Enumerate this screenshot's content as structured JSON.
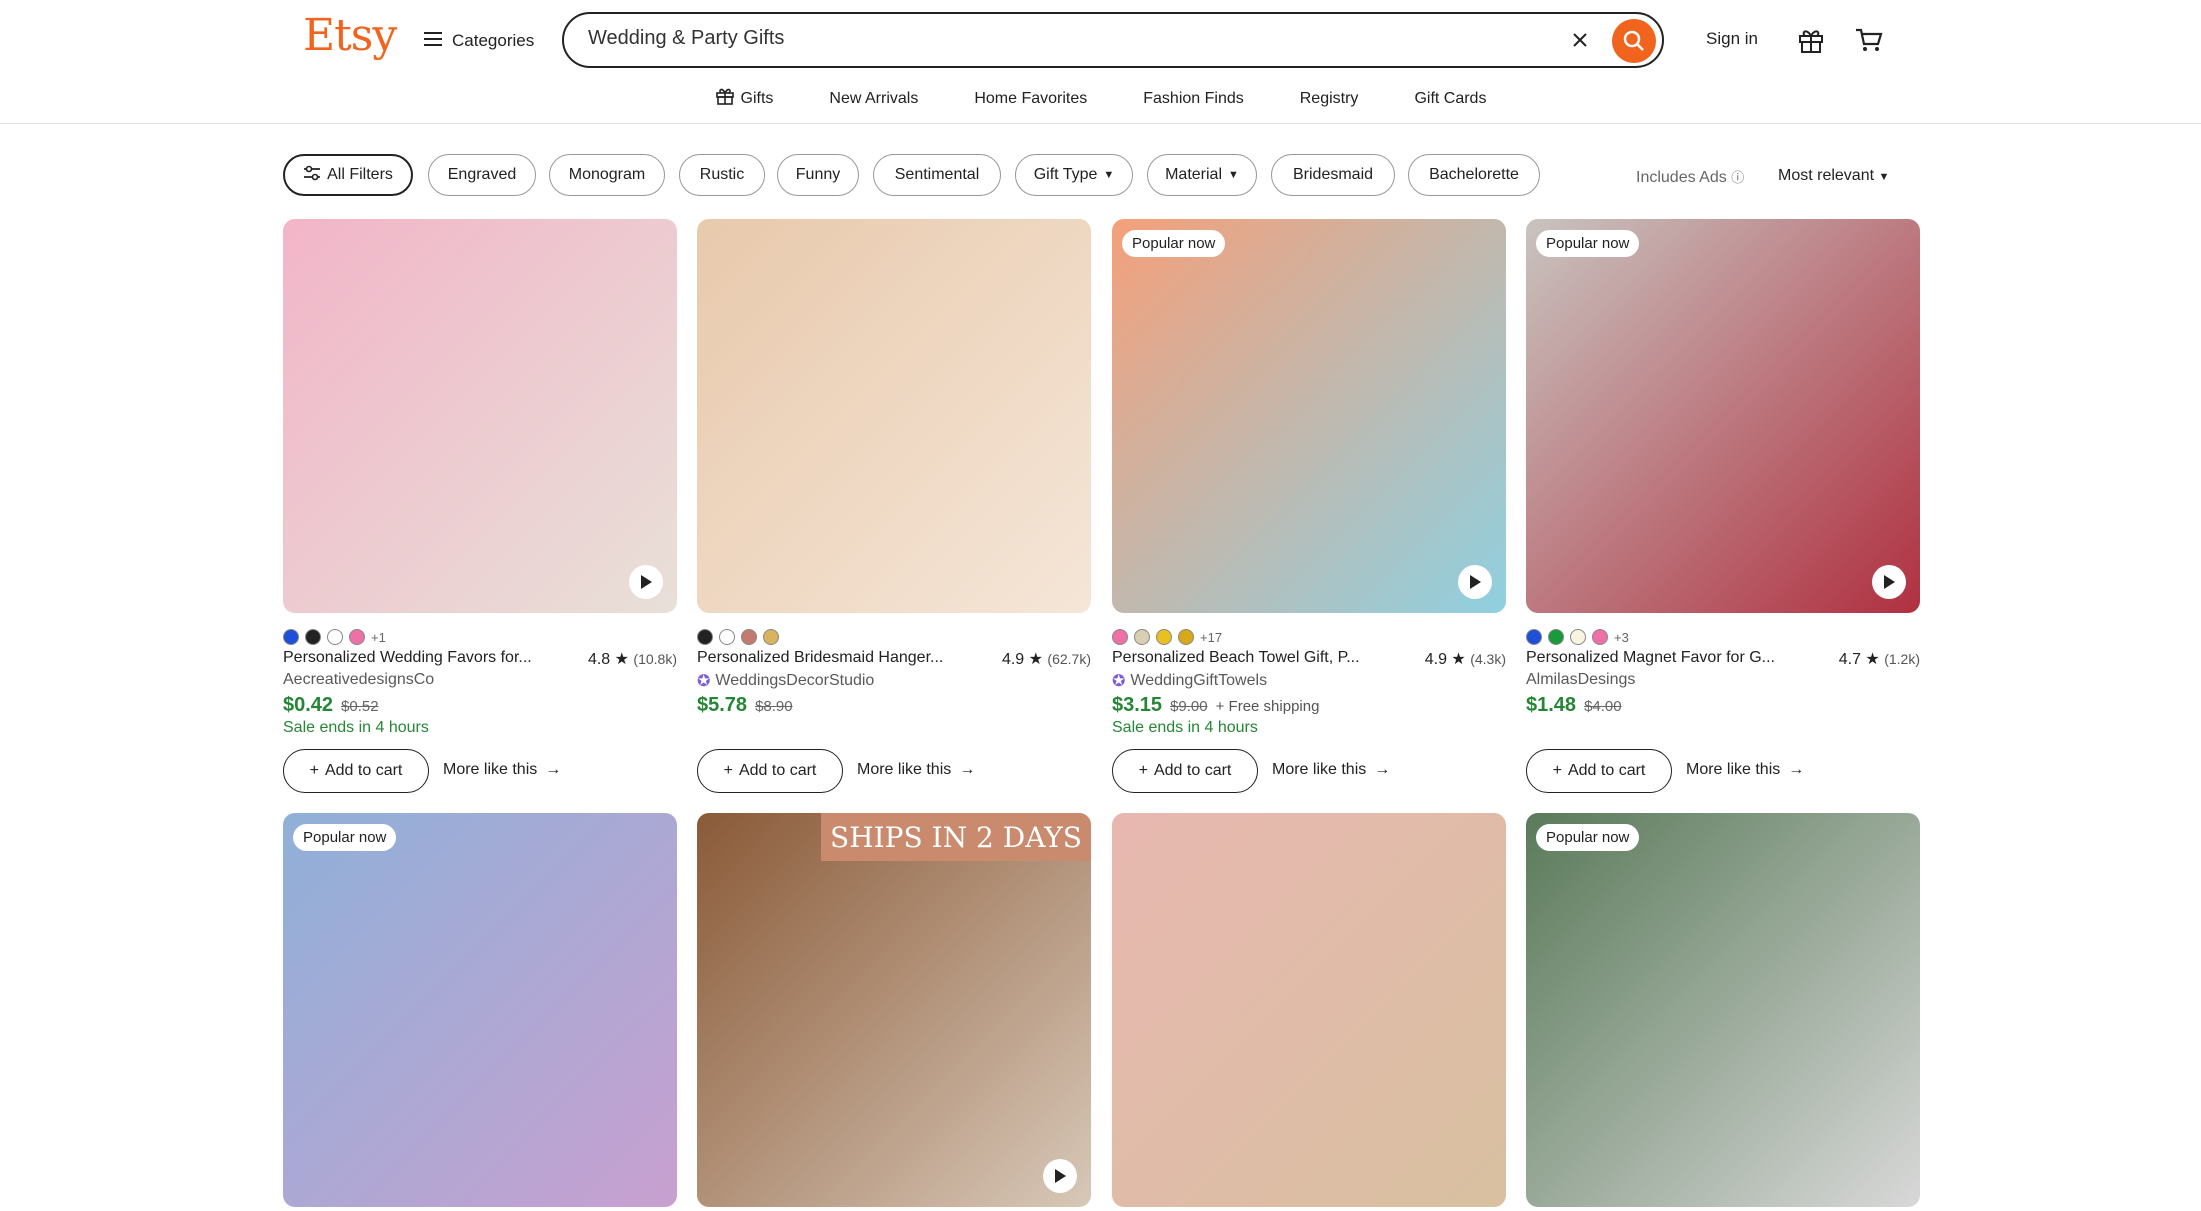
{
  "header": {
    "logo": "Etsy",
    "categories_label": "Categories",
    "search_value": "Wedding & Party Gifts",
    "signin": "Sign in",
    "nav": [
      "Gifts",
      "New Arrivals",
      "Home Favorites",
      "Fashion Finds",
      "Registry",
      "Gift Cards"
    ]
  },
  "filters": {
    "all": "All Filters",
    "chips": [
      "Engraved",
      "Monogram",
      "Rustic",
      "Funny",
      "Sentimental",
      "Gift Type",
      "Material",
      "Bridesmaid",
      "Bachelorette"
    ],
    "ads": "Includes Ads",
    "sort": "Most relevant"
  },
  "common": {
    "add_to_cart": "Add to cart",
    "more_like": "More like this"
  },
  "products": [
    {
      "title": "Personalized Wedding Favors for...",
      "rating": "4.8",
      "count": "(10.8k)",
      "shop": "AecreativedesignsCo",
      "star_seller": false,
      "price": "$0.42",
      "orig": "$0.52",
      "shipping": "",
      "sale": "Sale ends in 4 hours",
      "badge": "",
      "swatches": [
        "#1e4fd8",
        "#222222",
        "#ffffff",
        "#ef6fa7"
      ],
      "more_swatches": "+1",
      "video": true,
      "colors": [
        "#f2b5c8",
        "#e8e0d8"
      ]
    },
    {
      "title": "Personalized Bridesmaid Hanger...",
      "rating": "4.9",
      "count": "(62.7k)",
      "shop": "WeddingsDecorStudio",
      "star_seller": true,
      "price": "$5.78",
      "orig": "$8.90",
      "shipping": "",
      "sale": "",
      "badge": "",
      "swatches": [
        "#222222",
        "#ffffff",
        "#c27b6e",
        "#d8b460"
      ],
      "more_swatches": "",
      "video": false,
      "colors": [
        "#e8c9ac",
        "#f5e6d8"
      ]
    },
    {
      "title": "Personalized Beach Towel Gift, P...",
      "rating": "4.9",
      "count": "(4.3k)",
      "shop": "WeddingGiftTowels",
      "star_seller": true,
      "price": "$3.15",
      "orig": "$9.00",
      "shipping": "+ Free shipping",
      "sale": "Sale ends in 4 hours",
      "badge": "Popular now",
      "swatches": [
        "#ef6fa7",
        "#d8d0b0",
        "#e8c020",
        "#d8a818"
      ],
      "more_swatches": "+17",
      "video": true,
      "colors": [
        "#f4a07a",
        "#8fd0e0"
      ]
    },
    {
      "title": "Personalized Magnet Favor for G...",
      "rating": "4.7",
      "count": "(1.2k)",
      "shop": "AlmilasDesings",
      "star_seller": false,
      "price": "$1.48",
      "orig": "$4.00",
      "shipping": "",
      "sale": "",
      "badge": "Popular now",
      "swatches": [
        "#1e4fd8",
        "#1a9a3a",
        "#f8f4e0",
        "#ef6fa7"
      ],
      "more_swatches": "+3",
      "video": true,
      "colors": [
        "#c8c4c0",
        "#b03040"
      ]
    },
    {
      "title": "",
      "badge": "Popular now",
      "video": false,
      "colors": [
        "#8fb0d8",
        "#c8a0d0"
      ]
    },
    {
      "title": "",
      "badge": "",
      "banner": "SHIPS IN 2 DAYS",
      "video": true,
      "colors": [
        "#8a5a38",
        "#d8c8b8"
      ]
    },
    {
      "title": "",
      "badge": "",
      "video": false,
      "colors": [
        "#e8b8b0",
        "#d8c0a0"
      ]
    },
    {
      "title": "",
      "badge": "Popular now",
      "video": false,
      "colors": [
        "#5a7a5a",
        "#d8d8d8"
      ]
    }
  ]
}
